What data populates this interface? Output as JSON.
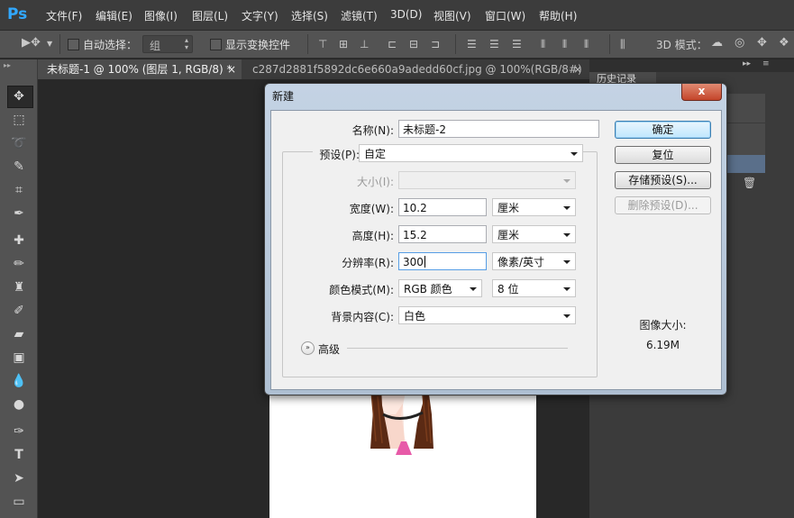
{
  "app": {
    "logo": "Ps"
  },
  "menubar": {
    "items": [
      "文件(F)",
      "编辑(E)",
      "图像(I)",
      "图层(L)",
      "文字(Y)",
      "选择(S)",
      "滤镜(T)",
      "3D(D)",
      "视图(V)",
      "窗口(W)",
      "帮助(H)"
    ]
  },
  "options_bar": {
    "auto_select_label": "自动选择：",
    "auto_select_target": "组",
    "show_transform_label": "显示变换控件",
    "mode_3d_label": "3D 模式："
  },
  "tabs": [
    {
      "title": "未标题-1 @ 100% (图层 1, RGB/8) *",
      "close": "×"
    },
    {
      "title": "c287d2881f5892dc6e660a9adedd60cf.jpg @ 100%(RGB/8#)",
      "close": "×"
    }
  ],
  "right_panel": {
    "history_tab": "历史记录",
    "collapse": "▸▸",
    "menu": "≡"
  },
  "dialog": {
    "title": "新建",
    "name_label": "名称(N):",
    "name_value": "未标题-2",
    "preset_label": "预设(P):",
    "preset_value": "自定",
    "size_label": "大小(I):",
    "size_value": "",
    "width_label": "宽度(W):",
    "width_value": "10.2",
    "width_unit": "厘米",
    "height_label": "高度(H):",
    "height_value": "15.2",
    "height_unit": "厘米",
    "resolution_label": "分辨率(R):",
    "resolution_value": "300",
    "resolution_unit": "像素/英寸",
    "color_mode_label": "颜色模式(M):",
    "color_mode_value": "RGB 颜色",
    "bit_depth_value": "8 位",
    "background_label": "背景内容(C):",
    "background_value": "白色",
    "advanced_label": "高级",
    "ok_button": "确定",
    "reset_button": "复位",
    "save_preset_button": "存储预设(S)...",
    "delete_preset_button": "删除预设(D)...",
    "image_size_label": "图像大小:",
    "image_size_value": "6.19M",
    "close_glyph": "x"
  }
}
